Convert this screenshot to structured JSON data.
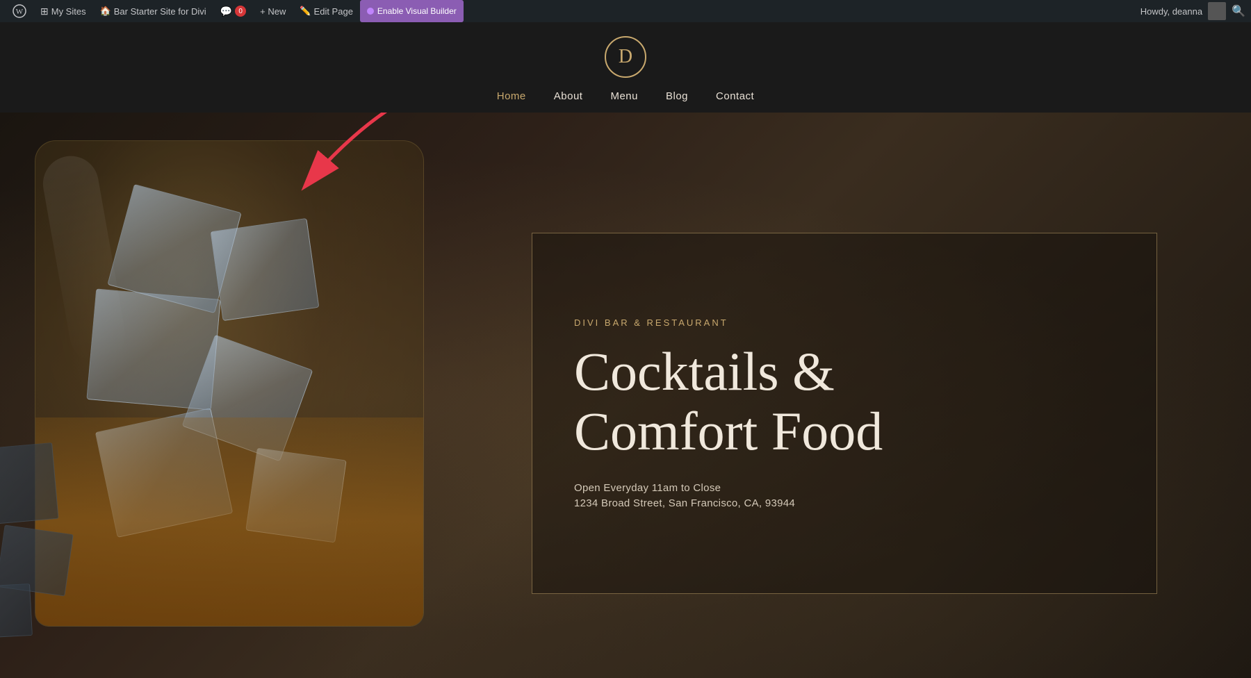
{
  "adminBar": {
    "wpLabel": "WordPress",
    "mySites": "My Sites",
    "siteName": "Bar Starter Site for Divi",
    "comments": "0",
    "new": "+ New",
    "editPage": "Edit Page",
    "enableVisualBuilder": "Enable Visual Builder",
    "howdy": "Howdy, deanna",
    "searchIcon": "search-icon"
  },
  "siteHeader": {
    "logoLetter": "D",
    "nav": {
      "home": "Home",
      "about": "About",
      "menu": "Menu",
      "blog": "Blog",
      "contact": "Contact"
    }
  },
  "hero": {
    "eyebrow": "DIVI BAR & RESTAURANT",
    "headline_line1": "Cocktails &",
    "headline_line2": "Comfort Food",
    "hours": "Open Everyday 11am to Close",
    "address": "1234 Broad Street, San Francisco, CA, 93944"
  },
  "colors": {
    "gold": "#c9a96e",
    "adminBg": "#1d2327",
    "siteBg": "#1a1a1a",
    "heroBg": "#2a2520",
    "textLight": "#f0e8dc",
    "textMid": "#d4c9b8",
    "diviPurple": "#8b5db3",
    "arrowRed": "#e8374a"
  }
}
